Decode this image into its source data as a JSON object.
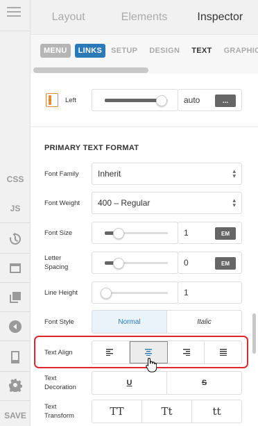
{
  "rail": {
    "items": [
      {
        "label": "CSS",
        "icon": ""
      },
      {
        "label": "JS",
        "icon": ""
      },
      {
        "label": "",
        "icon": "history-icon"
      },
      {
        "label": "",
        "icon": "window-icon"
      },
      {
        "label": "",
        "icon": "layers-icon"
      },
      {
        "label": "",
        "icon": "preview-icon"
      },
      {
        "label": "",
        "icon": "device-icon"
      },
      {
        "label": "",
        "icon": "gear-icon"
      }
    ],
    "save_label": "SAVE"
  },
  "top_tabs": {
    "layout": "Layout",
    "elements": "Elements",
    "inspector": "Inspector"
  },
  "sub_tabs": {
    "menu": "MENU",
    "links": "LINKS",
    "setup": "SETUP",
    "design": "DESIGN",
    "text": "TEXT",
    "graphics": "GRAPHICS"
  },
  "position_left": {
    "label": "Left",
    "value": "auto",
    "action": "..."
  },
  "primary_text_format": {
    "title": "PRIMARY TEXT FORMAT",
    "font_family": {
      "label": "Font Family",
      "value": "Inherit"
    },
    "font_weight": {
      "label": "Font Weight",
      "value": "400 – Regular"
    },
    "font_size": {
      "label": "Font Size",
      "value": "1",
      "unit": "EM",
      "level": 0.25
    },
    "letter_spacing": {
      "label_1": "Letter",
      "label_2": "Spacing",
      "value": "0",
      "unit": "EM",
      "level": 0.25
    },
    "line_height": {
      "label": "Line Height",
      "value": "1",
      "level": 0.05
    },
    "font_style": {
      "label": "Font Style",
      "options": [
        "Normal",
        "Italic"
      ],
      "selected": "Normal"
    },
    "text_align": {
      "label": "Text Align",
      "options": [
        "left",
        "center",
        "right",
        "justify"
      ],
      "selected": "center"
    },
    "text_decoration": {
      "label_1": "Text",
      "label_2": "Decoration",
      "underline": "U",
      "strike": "S"
    },
    "text_transform": {
      "label_1": "Text",
      "label_2": "Transform",
      "options": [
        "TT",
        "Tt",
        "tt"
      ]
    }
  },
  "colors": {
    "accent": "#2b7ab8",
    "highlight": "#e0262e",
    "unit_button": "#666666"
  }
}
